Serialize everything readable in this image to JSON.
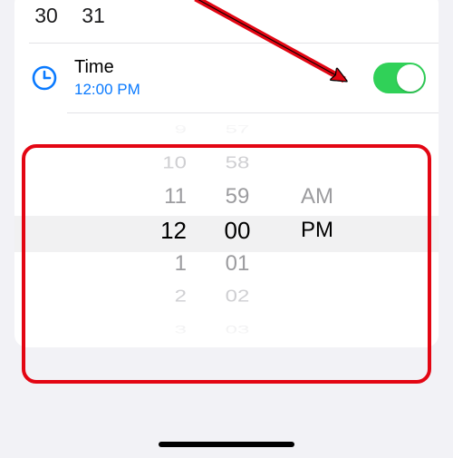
{
  "calendar": {
    "trailing_days": [
      "30",
      "31"
    ]
  },
  "time_row": {
    "label": "Time",
    "value": "12:00 PM",
    "toggle_on": true
  },
  "picker": {
    "hours": {
      "visible": [
        "9",
        "10",
        "11",
        "12",
        "1",
        "2",
        "3"
      ],
      "selected_index": 3
    },
    "minutes": {
      "visible": [
        "57",
        "58",
        "59",
        "00",
        "01",
        "02",
        "03"
      ],
      "selected_index": 3
    },
    "ampm": {
      "visible": [
        "AM",
        "PM"
      ],
      "selected_index": 1
    }
  },
  "colors": {
    "accent": "#0a7aff",
    "toggle_on": "#30d158",
    "highlight_border": "#e30613"
  }
}
